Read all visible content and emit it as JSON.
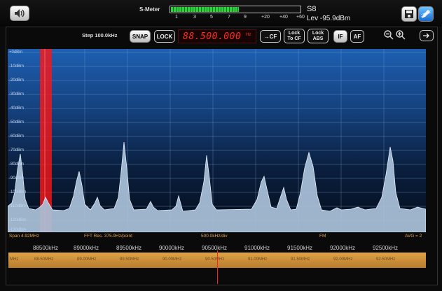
{
  "smeter": {
    "title": "S-Meter",
    "scale": [
      "1",
      "3",
      "5",
      "7",
      "9",
      "+20",
      "+40",
      "+60"
    ],
    "level_fraction": 0.52,
    "s_reading": "S8",
    "level_text": "Lev -95.9dBm"
  },
  "toolbar": {
    "step": "Step 100.0kHz",
    "snap": "SNAP",
    "lock": "LOCK",
    "frequency": "88.500.000",
    "freq_unit": "Hz",
    "to_cf": "→CF",
    "lock_to_cf": [
      "Lock",
      "To CF"
    ],
    "lock_abs": [
      "Lock",
      "ABS"
    ],
    "if": "IF",
    "af": "AF"
  },
  "spectrum": {
    "y_labels": [
      "+0dBm",
      "-10dBm",
      "-20dBm",
      "-30dBm",
      "-40dBm",
      "-50dBm",
      "-60dBm",
      "-70dBm",
      "-80dBm",
      "-90dBm",
      "-100dBm",
      "-110dBm",
      "-120dBm",
      "-130dBm"
    ]
  },
  "status": {
    "span": "Span 4.92MHz",
    "fft": "FFT Res. 375.9Hz/point",
    "div": "500.0kHz/div",
    "mode": "FM",
    "avg": "AVG = 2"
  },
  "freq_axis": [
    "88500kHz",
    "89000kHz",
    "89500kHz",
    "90000kHz",
    "90500kHz",
    "91000kHz",
    "91500kHz",
    "92000kHz",
    "92500kHz"
  ],
  "band_labels": [
    "MHz",
    "88.50MHz",
    "89.00MHz",
    "89.50MHz",
    "90.00MHz",
    "90.50MHz",
    "91.00MHz",
    "91.50MHz",
    "92.00MHz",
    "92.50MHz"
  ],
  "colors": {
    "accent": "#e1a347",
    "spectrum_fill": "#a8c0d8",
    "marker": "#ff2020"
  }
}
